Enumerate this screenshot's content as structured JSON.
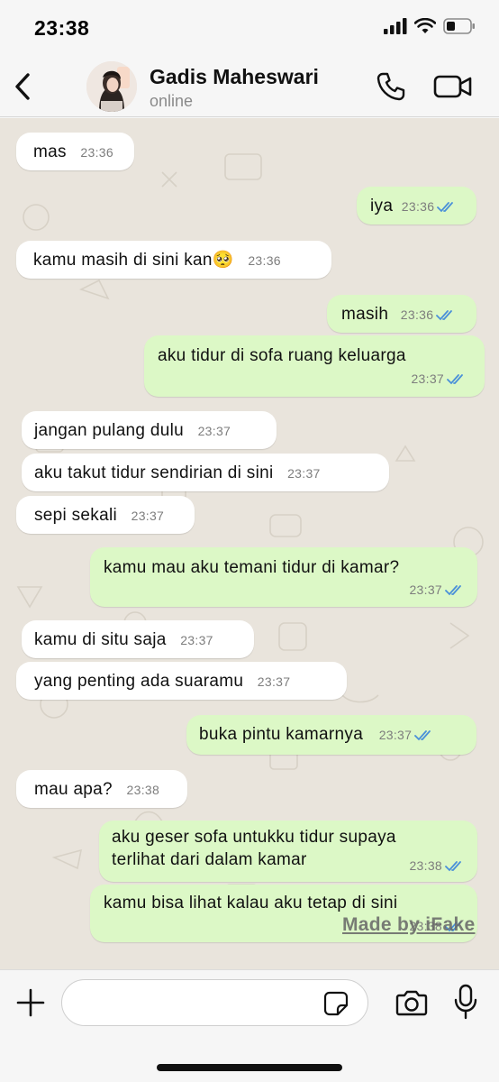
{
  "status_bar": {
    "time": "23:38"
  },
  "header": {
    "contact_name": "Gadis Maheswari",
    "contact_status": "online"
  },
  "messages": [
    {
      "dir": "in",
      "text": "mas",
      "time": "23:36"
    },
    {
      "dir": "out",
      "text": "iya",
      "time": "23:36",
      "read": true
    },
    {
      "dir": "in",
      "text": "kamu masih di sini kan🥺",
      "time": "23:36"
    },
    {
      "dir": "out",
      "text": "masih",
      "time": "23:36",
      "read": true
    },
    {
      "dir": "out",
      "text": "aku tidur di sofa ruang keluarga",
      "time": "23:37",
      "read": true
    },
    {
      "dir": "in",
      "text": "jangan pulang dulu",
      "time": "23:37"
    },
    {
      "dir": "in",
      "text": "aku takut tidur sendirian di sini",
      "time": "23:37"
    },
    {
      "dir": "in",
      "text": "sepi sekali",
      "time": "23:37"
    },
    {
      "dir": "out",
      "text": "kamu mau aku temani tidur di kamar?",
      "time": "23:37",
      "read": true
    },
    {
      "dir": "in",
      "text": "kamu di situ saja",
      "time": "23:37"
    },
    {
      "dir": "in",
      "text": "yang penting ada suaramu",
      "time": "23:37"
    },
    {
      "dir": "out",
      "text": "buka pintu kamarnya",
      "time": "23:37",
      "read": true
    },
    {
      "dir": "in",
      "text": "mau apa?",
      "time": "23:38"
    },
    {
      "dir": "out",
      "text": "aku geser sofa untukku tidur supaya terlihat dari dalam kamar",
      "time": "23:38",
      "read": true
    },
    {
      "dir": "out",
      "text": "kamu bisa lihat kalau aku tetap di sini",
      "time": "23:38",
      "read": true
    }
  ],
  "watermark": "Made by iFake",
  "input": {
    "placeholder": ""
  },
  "colors": {
    "incoming_bubble": "#ffffff",
    "outgoing_bubble": "#dcf8c6",
    "chat_background": "#e9e4dc",
    "read_ticks": "#4a90d9"
  },
  "icons": {
    "back": "chevron-left-icon",
    "call": "phone-icon",
    "video": "video-camera-icon",
    "plus": "plus-icon",
    "sticker": "sticker-icon",
    "camera": "camera-icon",
    "mic": "microphone-icon"
  }
}
